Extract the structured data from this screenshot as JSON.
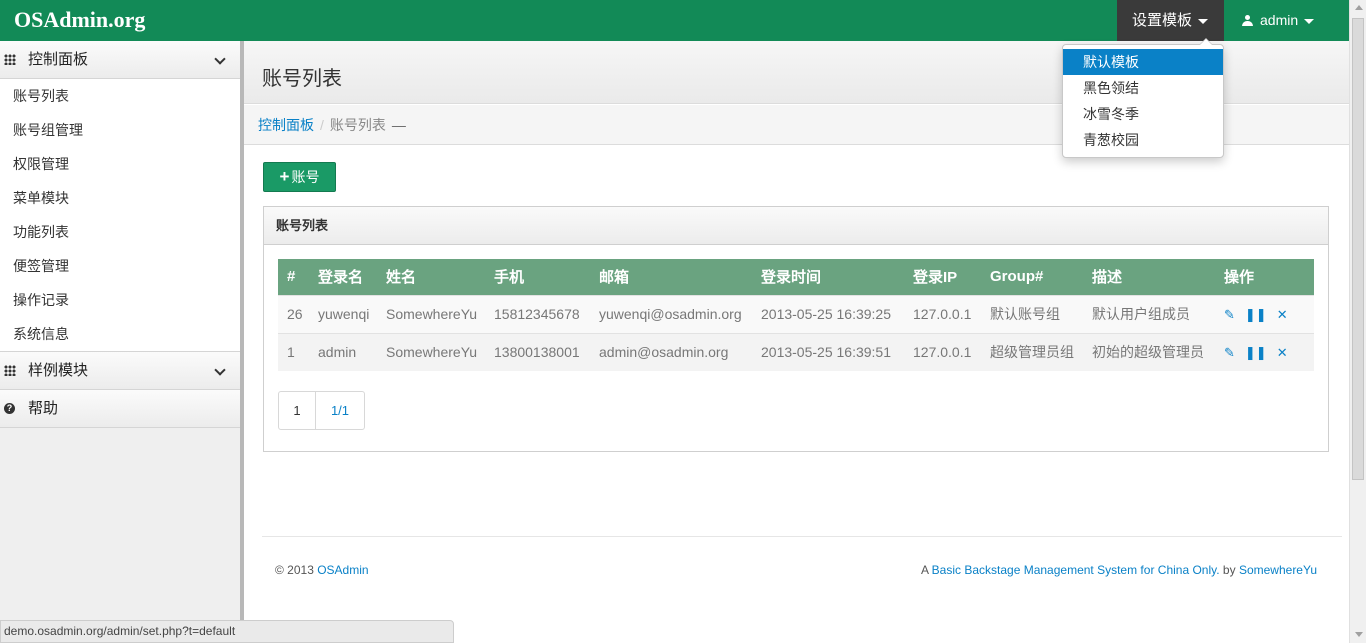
{
  "brand": "OSAdmin.org",
  "topnav": {
    "template_label": "设置模板",
    "user_label": "admin"
  },
  "template_menu": {
    "items": [
      "默认模板",
      "黑色领结",
      "冰雪冬季",
      "青葱校园"
    ],
    "active_index": 0
  },
  "sidebar": {
    "sections": [
      {
        "label": "控制面板",
        "icon": "grid-icon",
        "items": [
          "账号列表",
          "账号组管理",
          "权限管理",
          "菜单模块",
          "功能列表",
          "便签管理",
          "操作记录",
          "系统信息"
        ]
      },
      {
        "label": "样例模块",
        "icon": "grid-icon"
      },
      {
        "label": "帮助",
        "icon": "help-icon"
      }
    ]
  },
  "page": {
    "title": "账号列表",
    "breadcrumb": {
      "home": "控制面板",
      "current": "账号列表",
      "tail": "—"
    },
    "add_button": "账号"
  },
  "panel": {
    "title": "账号列表",
    "columns": [
      "#",
      "登录名",
      "姓名",
      "手机",
      "邮箱",
      "登录时间",
      "登录IP",
      "Group#",
      "描述",
      "操作"
    ],
    "rows": [
      [
        "26",
        "yuwenqi",
        "SomewhereYu",
        "15812345678",
        "yuwenqi@osadmin.org",
        "2013-05-25 16:39:25",
        "127.0.0.1",
        "默认账号组",
        "默认用户组成员"
      ],
      [
        "1",
        "admin",
        "SomewhereYu",
        "13800138001",
        "admin@osadmin.org",
        "2013-05-25 16:39:51",
        "127.0.0.1",
        "超级管理员组",
        "初始的超级管理员"
      ]
    ],
    "row_actions": [
      "pencil-icon",
      "pause-icon",
      "close-icon"
    ],
    "pager": {
      "current": "1",
      "total": "1/1"
    }
  },
  "footer": {
    "copyright": "© 2013",
    "brand_link": "OSAdmin",
    "tagline_prefix": "A",
    "tagline": "Basic Backstage Management System for China Only.",
    "by": "by",
    "author": "SomewhereYu"
  },
  "status_url": "demo.osadmin.org/admin/set.php?t=default",
  "colors": {
    "topbar": "#128a57",
    "accent": "#0a81c7",
    "table_header": "#6aa380",
    "button": "#1a9a66"
  }
}
